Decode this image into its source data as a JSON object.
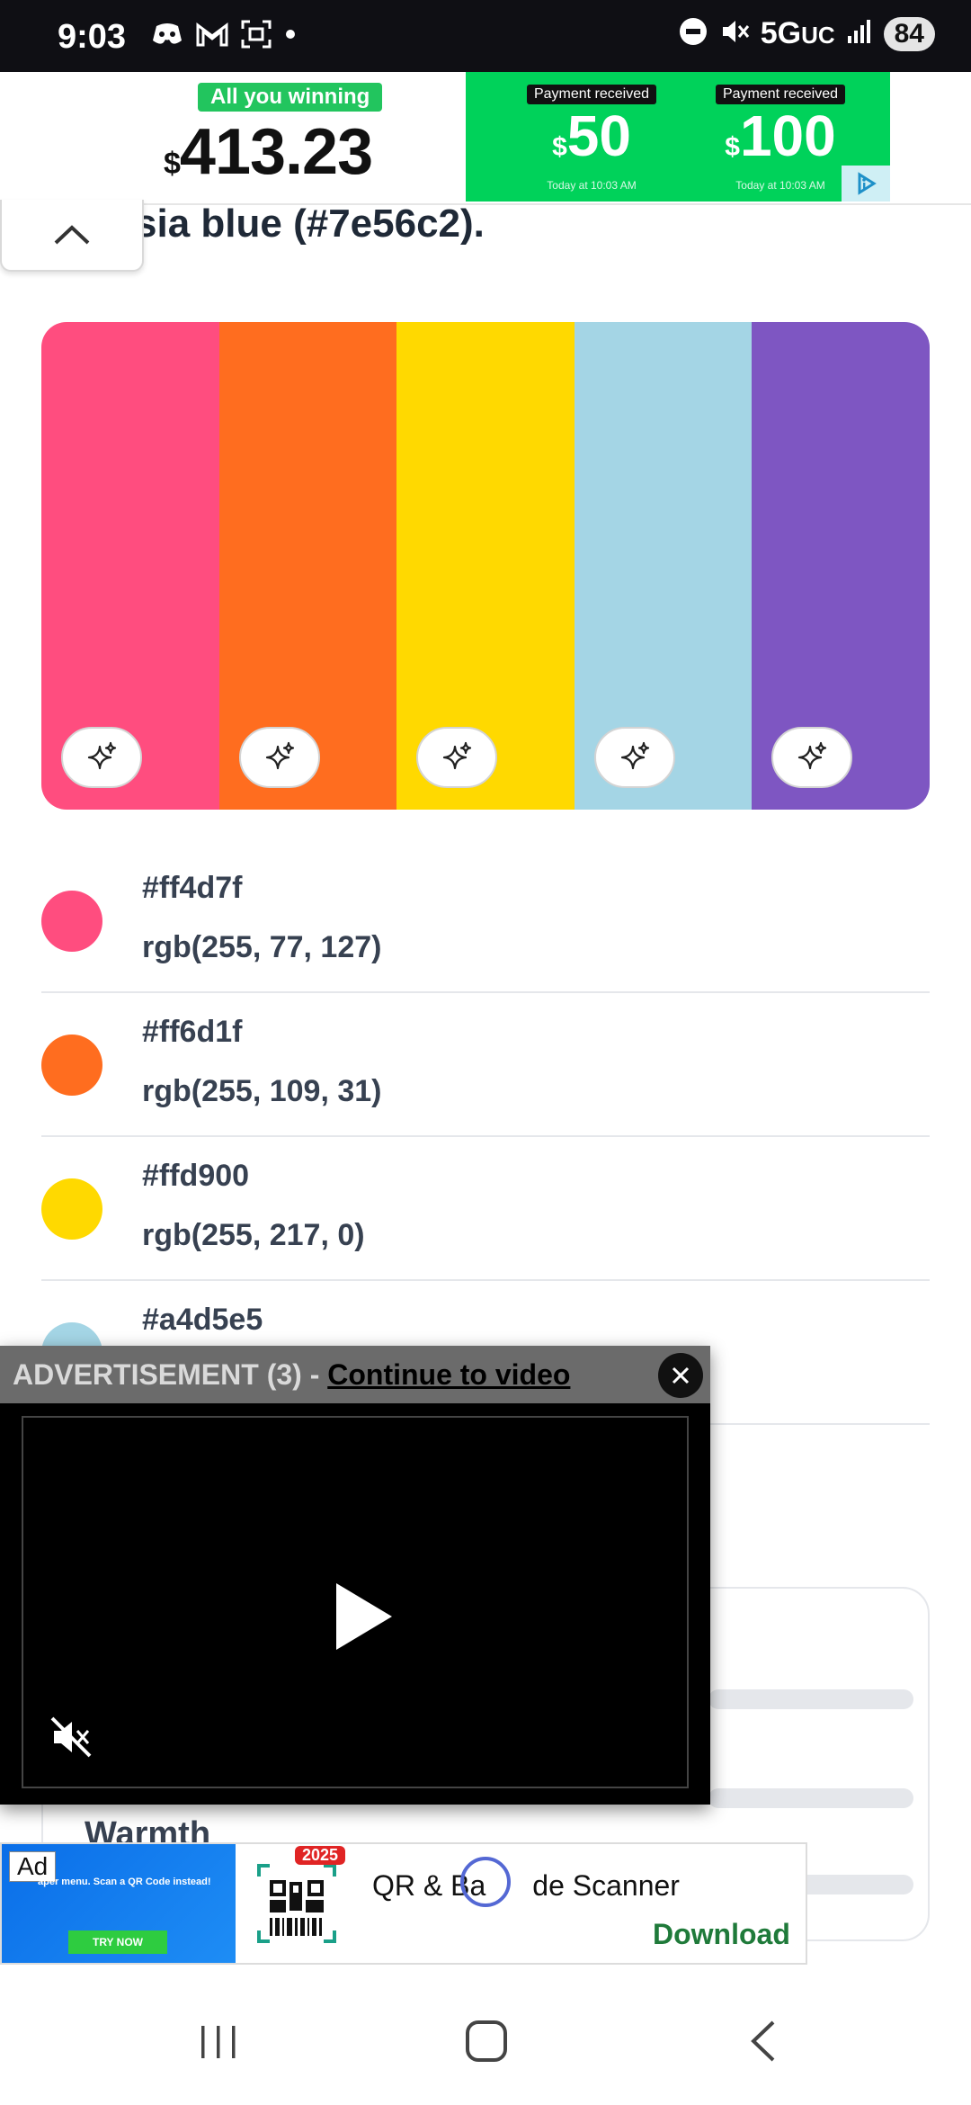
{
  "status_bar": {
    "time": "9:03",
    "network": "5G",
    "network_suffix": "UC",
    "battery": "84",
    "left_icons": [
      "discord-icon",
      "gmail-icon",
      "screenshot-icon",
      "dot-icon"
    ],
    "right_icons": [
      "dnd-icon",
      "mute-icon",
      "signal-icon"
    ]
  },
  "top_ad": {
    "pill": "All you winning",
    "amount_symbol": "$",
    "amount": "413.23",
    "cards": [
      {
        "label": "Payment received",
        "currency": "$",
        "value": "50",
        "sub": "Today at 10:03 AM"
      },
      {
        "label": "Payment received",
        "currency": "$",
        "value": "100",
        "sub": "Today at 10:03 AM"
      }
    ]
  },
  "page": {
    "heading": "sia blue (#7e56c2)."
  },
  "palette": [
    {
      "hex": "#ff4d7f",
      "rgb": "rgb(255, 77, 127)"
    },
    {
      "hex": "#ff6d1f",
      "rgb": "rgb(255, 109, 31)"
    },
    {
      "hex": "#ffd900",
      "rgb": "rgb(255, 217, 0)"
    },
    {
      "hex": "#a4d5e5",
      "rgb": ""
    },
    {
      "hex": "#7e56c2",
      "rgb": ""
    }
  ],
  "partial_card": {
    "label": "Warmth"
  },
  "video_ad": {
    "title_prefix": "ADVERTISEMENT (3) - ",
    "link": "Continue to video"
  },
  "app_ad": {
    "ad_label": "Ad",
    "image_text": "aper menu. Scan a QR Code instead!",
    "image_button": "TRY NOW",
    "year": "2025",
    "name": "QR & Barcode Scanner",
    "name_visible": "QR & Ba",
    "name_visible_tail": "de Scanner",
    "cta": "Download"
  },
  "colors": {
    "status_bg": "#0f0f14",
    "ad_green": "#00d25a",
    "text": "#374151"
  }
}
